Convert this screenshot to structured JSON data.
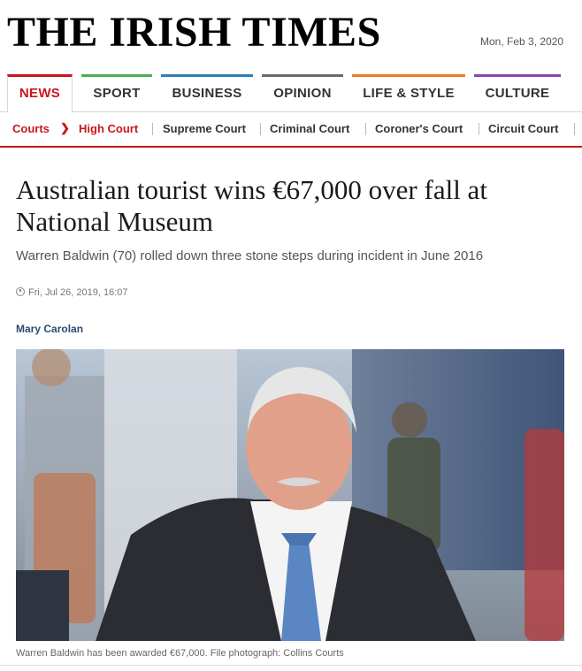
{
  "masthead": {
    "logo": "THE IRISH TIMES",
    "date": "Mon, Feb 3, 2020"
  },
  "primary_nav": [
    {
      "label": "NEWS",
      "color": "#c8161d"
    },
    {
      "label": "SPORT",
      "color": "#4caf50"
    },
    {
      "label": "BUSINESS",
      "color": "#2c7fb8"
    },
    {
      "label": "OPINION",
      "color": "#6b6b6b"
    },
    {
      "label": "LIFE & STYLE",
      "color": "#e67e22"
    },
    {
      "label": "CULTURE",
      "color": "#8e44ad"
    }
  ],
  "secondary_nav": {
    "parent": "Courts",
    "current": "High Court",
    "items": [
      "Supreme Court",
      "Criminal Court",
      "Coroner's Court",
      "Circuit Court"
    ]
  },
  "article": {
    "headline": "Australian tourist wins €67,000 over fall at National Museum",
    "standfirst": "Warren Baldwin (70) rolled down three stone steps during incident in June 2016",
    "timestamp": "Fri, Jul 26, 2019, 16:07",
    "byline": "Mary Carolan",
    "caption": "Warren Baldwin has been awarded €67,000. File photograph: Collins Courts"
  },
  "colors": {
    "accent": "#c8161d",
    "byline": "#2b4a73"
  }
}
